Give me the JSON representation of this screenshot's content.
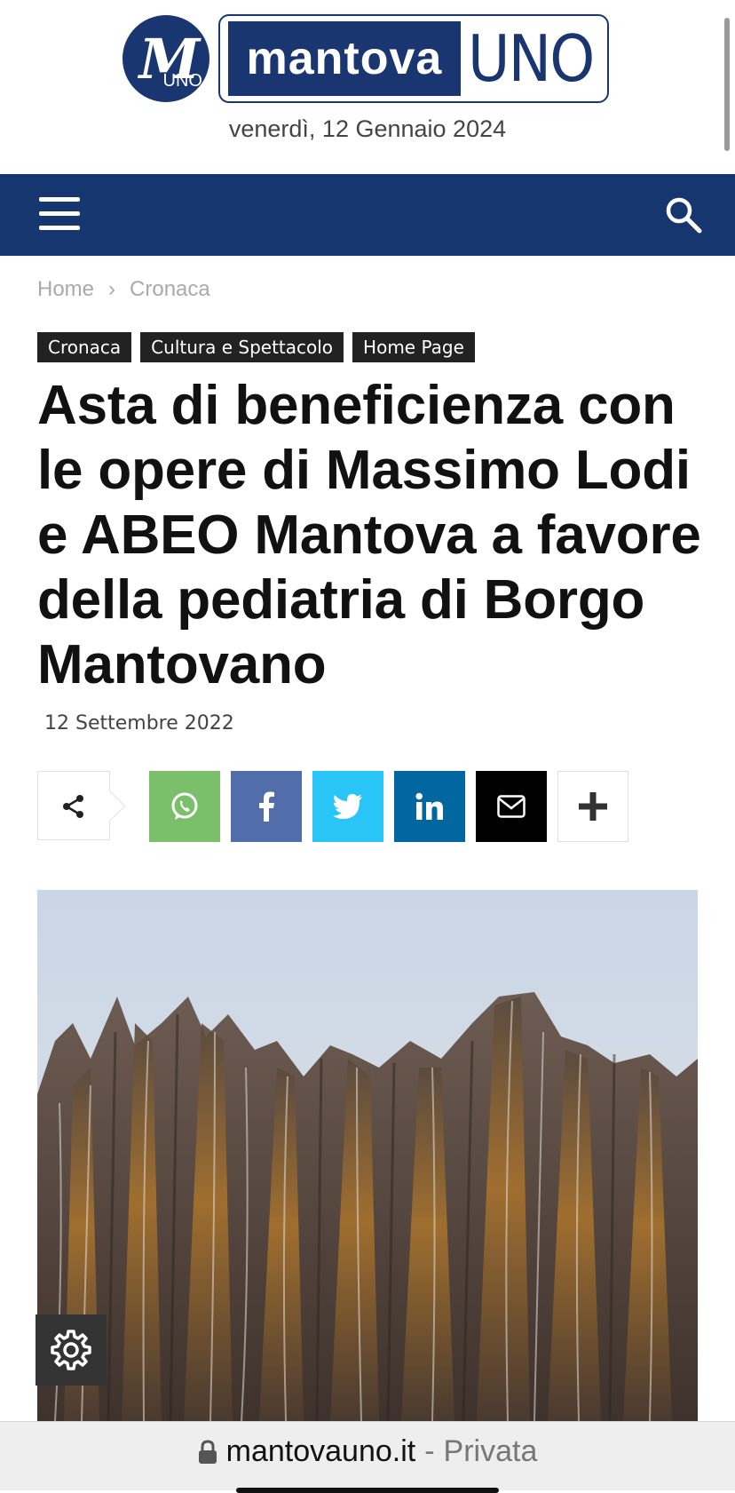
{
  "header": {
    "logo_mark_letter": "M",
    "logo_mark_small": "UNO",
    "logo_word_bold": "mantova",
    "logo_word_light": "UNO",
    "date": "venerdì, 12 Gennaio 2024"
  },
  "nav": {
    "menu_icon": "hamburger-icon",
    "search_icon": "search-icon",
    "background_color": "#16366f"
  },
  "breadcrumb": {
    "items": [
      "Home",
      "Cronaca"
    ],
    "separator": "›"
  },
  "article": {
    "tags": [
      "Cronaca",
      "Cultura e Spettacolo",
      "Home Page"
    ],
    "title": "Asta di beneficienza con le opere di Massimo Lodi e ABEO Mantova a favore della pediatria di Borgo Mantovano",
    "date": "12 Settembre 2022"
  },
  "share": {
    "buttons": [
      {
        "name": "share-icon",
        "color": "#ffffff"
      },
      {
        "name": "whatsapp-icon",
        "color": "#7bbf6a"
      },
      {
        "name": "facebook-icon",
        "color": "#516eab"
      },
      {
        "name": "twitter-icon",
        "color": "#29c5f6"
      },
      {
        "name": "linkedin-icon",
        "color": "#0266a0"
      },
      {
        "name": "mail-icon",
        "color": "#000000"
      },
      {
        "name": "plus-icon",
        "color": "#ffffff"
      }
    ]
  },
  "image": {
    "description_icon": "abstract-painting-image"
  },
  "cookie_settings": {
    "icon": "gear-icon"
  },
  "browser": {
    "lock_icon": "lock-icon",
    "domain": "mantovauno.it",
    "separator": "-",
    "mode": "Privata"
  }
}
